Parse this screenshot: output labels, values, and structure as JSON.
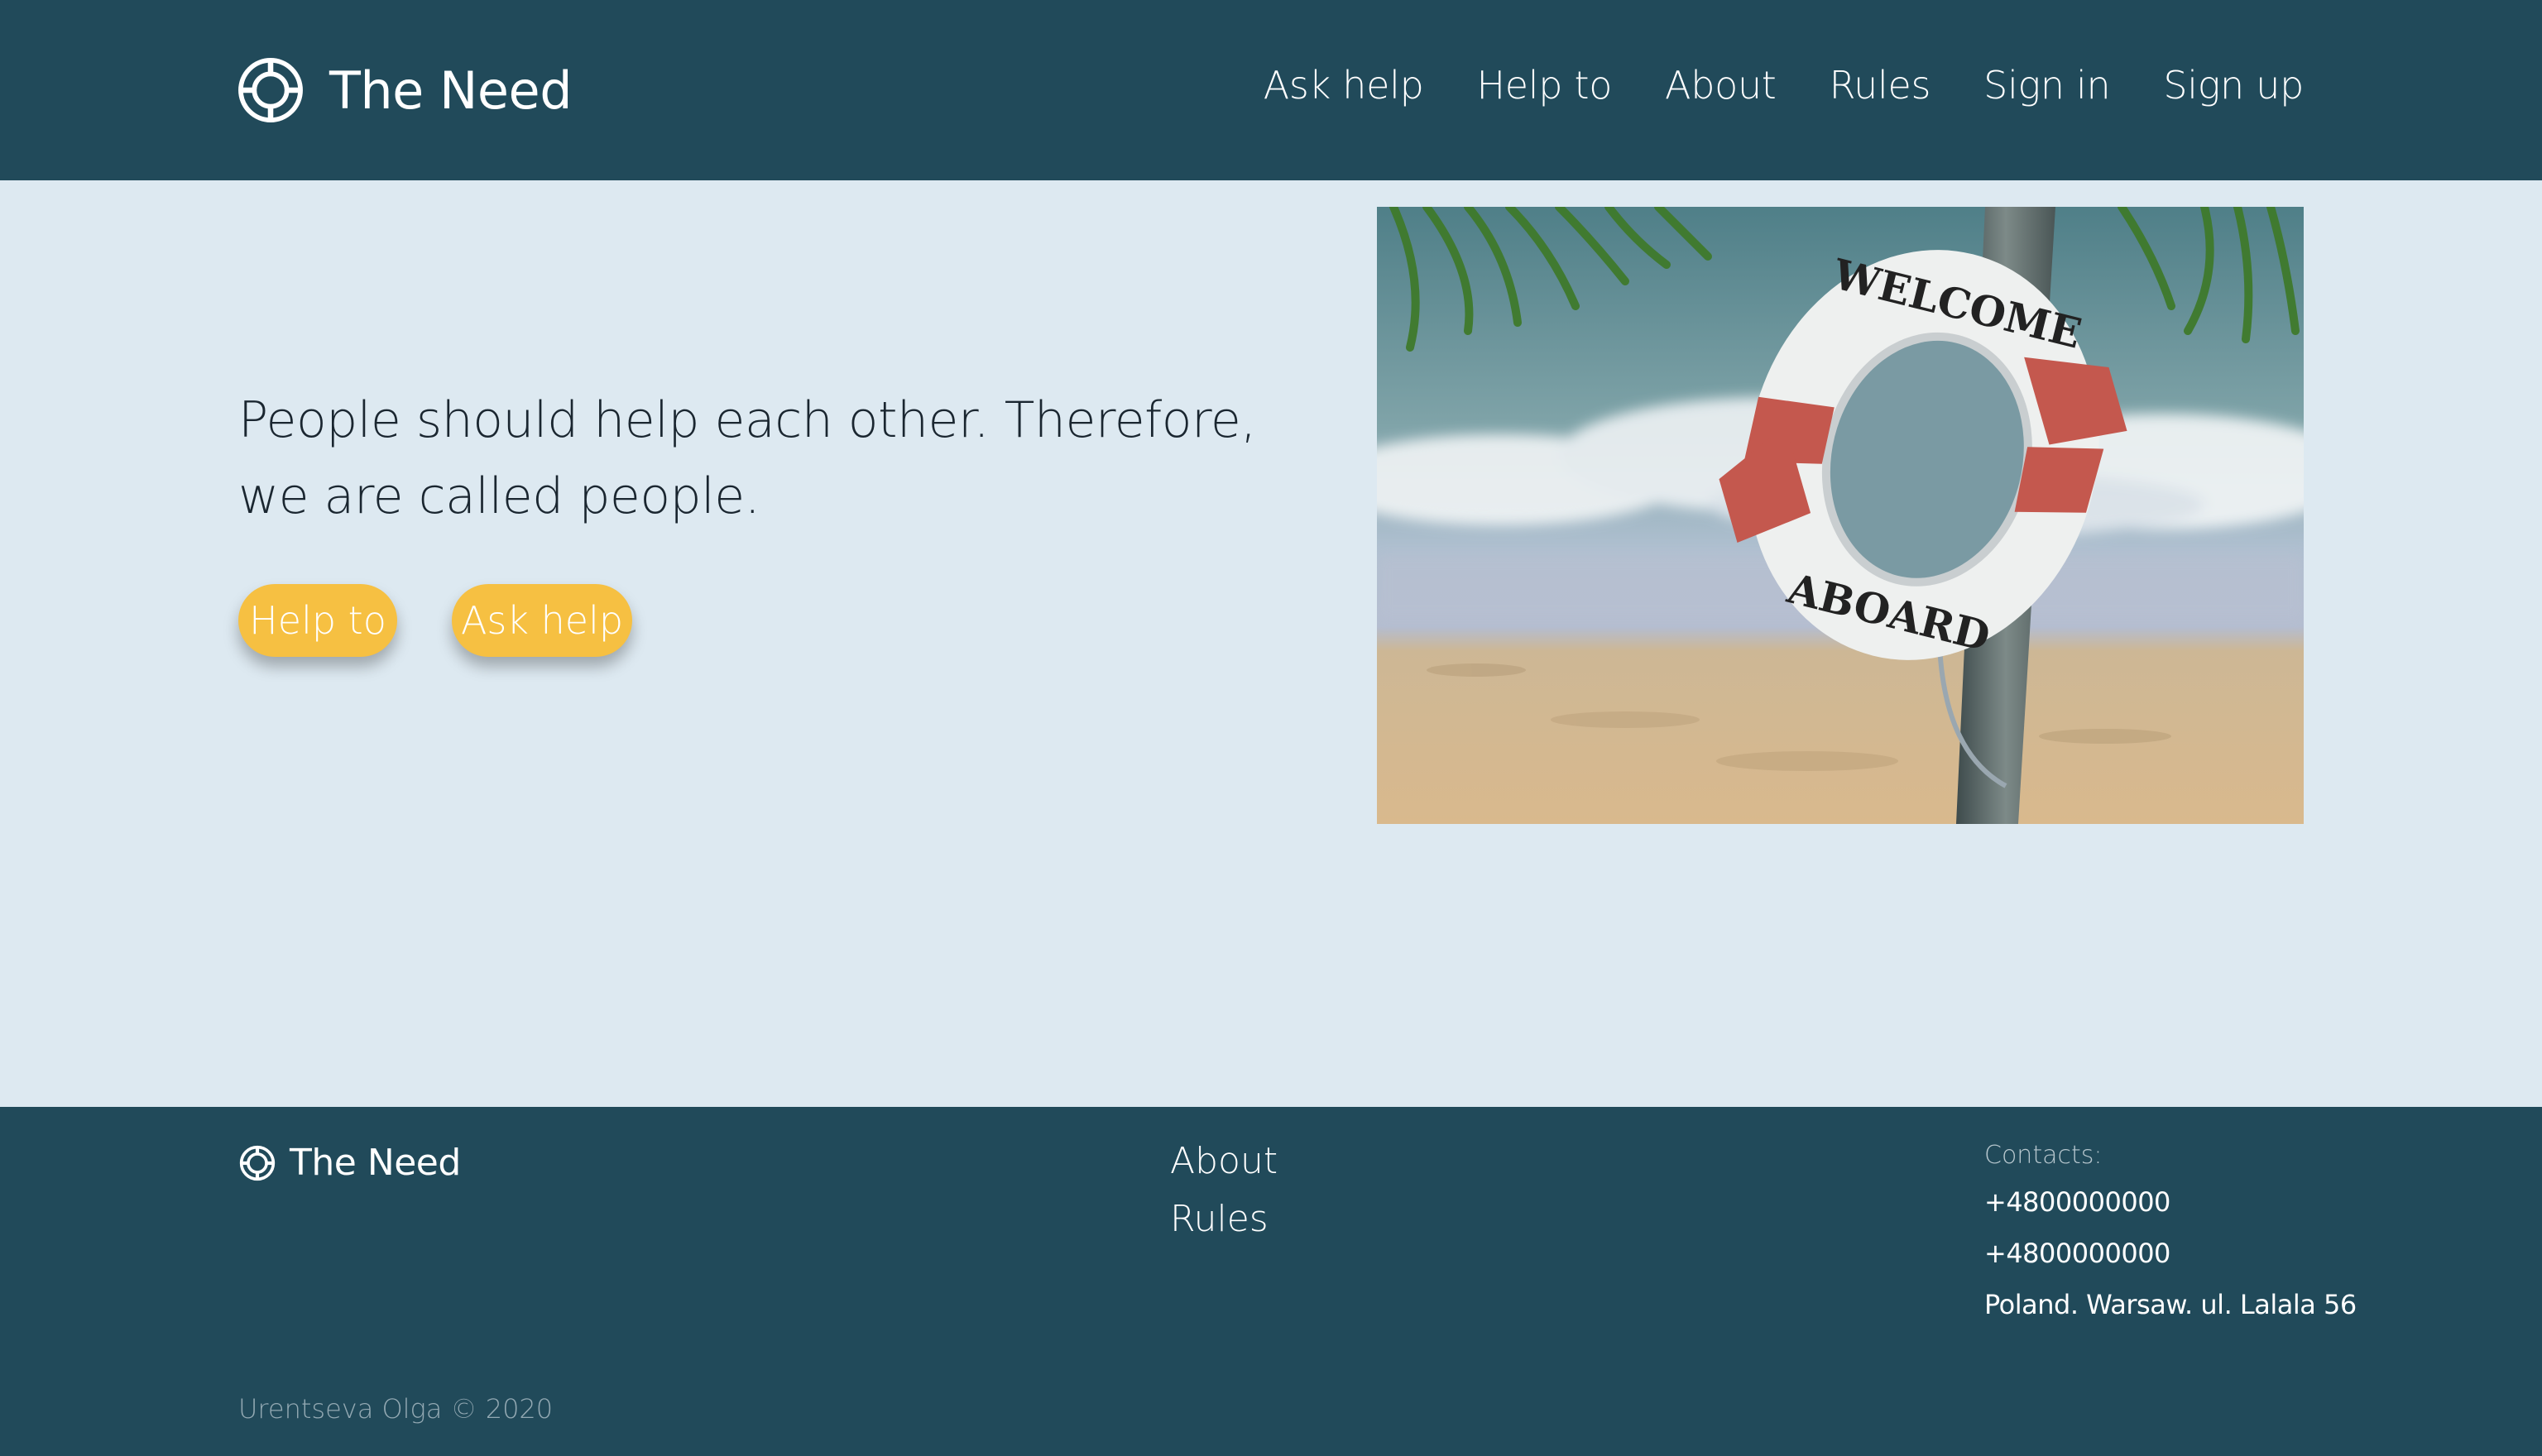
{
  "header": {
    "brand": "The Need",
    "logo_icon": "lifebuoy-icon",
    "nav": [
      "Ask help",
      "Help to",
      "About",
      "Rules",
      "Sign in",
      "Sign up"
    ]
  },
  "hero": {
    "text": "People should help each other. Therefore, we are called people.",
    "buttons": {
      "help_to": "Help to",
      "ask_help": "Ask help"
    },
    "image": {
      "ring_top_text": "WELCOME",
      "ring_bottom_text": "ABOARD"
    }
  },
  "footer": {
    "brand": "The Need",
    "links": [
      "About",
      "Rules"
    ],
    "contacts_label": "Contacts:",
    "phones": [
      "+4800000000",
      "+4800000000"
    ],
    "address": "Poland. Warsaw. ul. Lalala 56",
    "copyright": "Urentseva Olga © 2020"
  },
  "colors": {
    "header_bg": "#214a5a",
    "page_bg": "#dde9f1",
    "button_bg": "#f6c042",
    "text_white": "#ffffff"
  }
}
